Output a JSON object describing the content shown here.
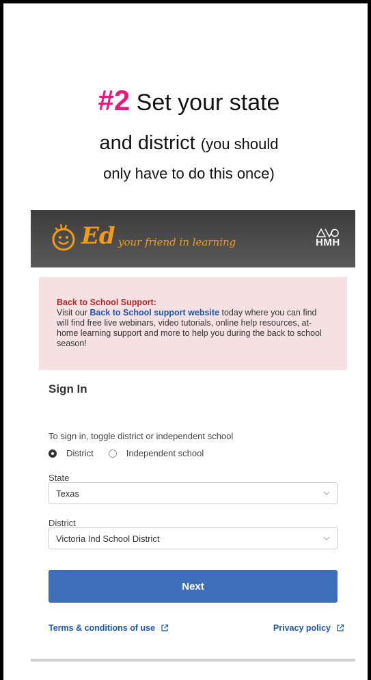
{
  "instructions": {
    "step_number": "#2",
    "line1_text": " Set your state",
    "line2_text": "and district ",
    "line2_note": "(you should",
    "line3_text": "only have to do this once)"
  },
  "header": {
    "logo_text": "Ed",
    "tagline": "your friend in learning",
    "brand_text": "HMH"
  },
  "banner": {
    "title": "Back to School Support:",
    "text_before_link": "Visit our ",
    "link_text": "Back to School support website",
    "text_after_link": " today where you can find will find free live webinars, video tutorials, online help resources, at-home learning support and more to help you during the back to school season!"
  },
  "sign_in": {
    "heading": "Sign In",
    "prompt": "To sign in, toggle district or independent school",
    "options": [
      {
        "label": "District",
        "selected": true
      },
      {
        "label": "Independent school",
        "selected": false
      }
    ],
    "state_label": "State",
    "state_value": "Texas",
    "district_label": "District",
    "district_value": "Victoria Ind School District",
    "next_label": "Next"
  },
  "footer": {
    "terms_label": "Terms & conditions of use",
    "privacy_label": "Privacy policy"
  },
  "colors": {
    "accent_pink": "#e6197e",
    "button_blue": "#3f6fba",
    "banner_bg": "#f6e1e2",
    "logo_orange": "#f39c12"
  }
}
